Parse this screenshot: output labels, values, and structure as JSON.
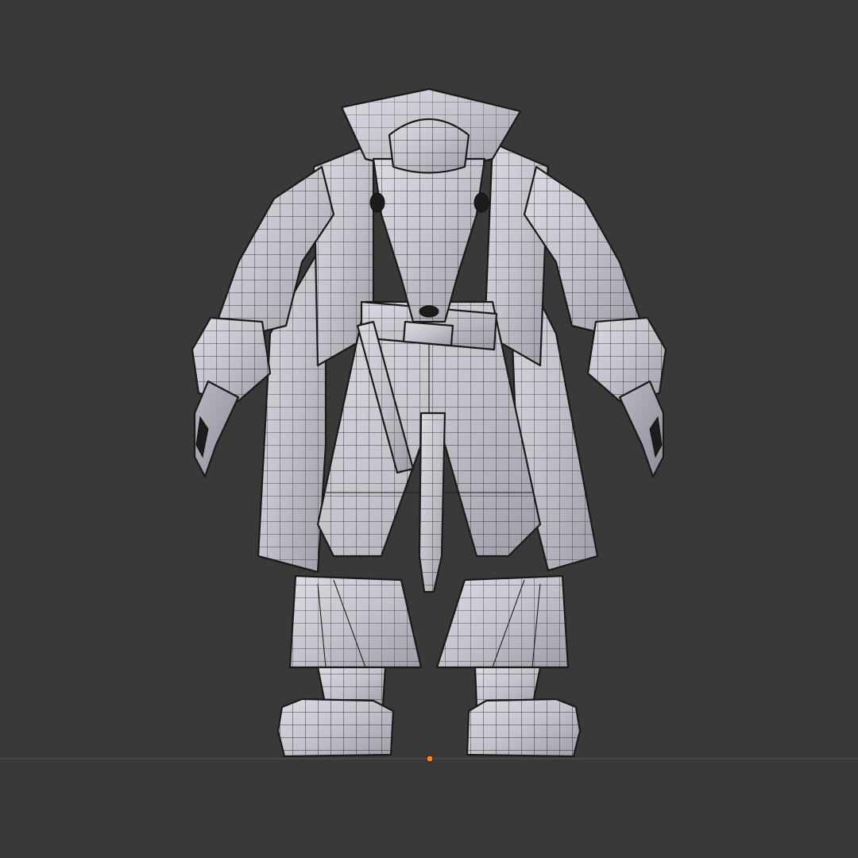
{
  "viewport": {
    "background": "#393939",
    "ground_line_color": "#4a4a4a",
    "mesh_color": "#c9c9d1",
    "wire_color": "#1a1a1a",
    "origin_color": "#f08a2a"
  },
  "model": {
    "icon": "rat-character-wireframe-icon"
  }
}
